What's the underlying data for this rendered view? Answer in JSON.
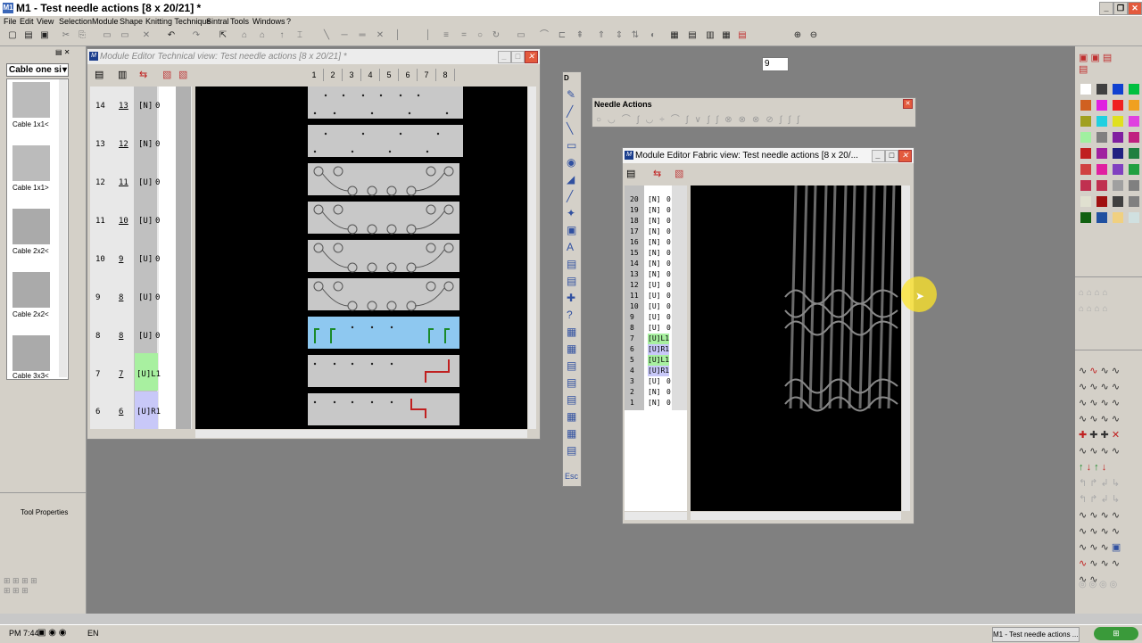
{
  "app": {
    "title": "M1 - Test needle actions [8 x 20/21] *",
    "icon": "M1"
  },
  "menu": [
    "File",
    "Edit",
    "View",
    "Selection",
    "Module",
    "Shape",
    "Knitting Technique",
    "Sintral",
    "Tools",
    "Windows",
    "?"
  ],
  "toolbar": {
    "zoom_value": "9"
  },
  "left_panel": {
    "dropdown": "Cable one si",
    "modules": [
      {
        "label": "Cable 1x1<"
      },
      {
        "label": "Cable 1x1>"
      },
      {
        "label": "Cable 2x2<"
      },
      {
        "label": "Cable 2x2<"
      },
      {
        "label": "Cable 3x3<"
      }
    ],
    "tool_properties": "Tool Properties"
  },
  "tech_view": {
    "title": "Module Editor Technical view: Test needle actions [8 x 20/21] *",
    "needles": [
      "1",
      "2",
      "3",
      "4",
      "5",
      "6",
      "7",
      "8"
    ],
    "rows": [
      {
        "n": "14",
        "m": "13",
        "code": "[N]",
        "v": "0"
      },
      {
        "n": "13",
        "m": "12",
        "code": "[N]",
        "v": "0"
      },
      {
        "n": "12",
        "m": "11",
        "code": "[U]",
        "v": "0"
      },
      {
        "n": "11",
        "m": "10",
        "code": "[U]",
        "v": "0"
      },
      {
        "n": "10",
        "m": "9",
        "code": "[U]",
        "v": "0"
      },
      {
        "n": "9",
        "m": "8",
        "code": "[U]",
        "v": "0"
      },
      {
        "n": "8",
        "m": "8",
        "code": "[U]",
        "v": "0"
      },
      {
        "n": "7",
        "m": "7",
        "code": "[U]L1",
        "v": ""
      },
      {
        "n": "6",
        "m": "6",
        "code": "[U]R1",
        "v": ""
      }
    ]
  },
  "vertical_toolbar": {
    "label": "D",
    "esc": "Esc"
  },
  "needle_actions": {
    "title": "Needle Actions"
  },
  "fabric_view": {
    "title": "Module Editor Fabric view: Test needle actions [8 x 20/...",
    "rows": [
      {
        "n": "20",
        "code": "[N]",
        "v": "0"
      },
      {
        "n": "19",
        "code": "[N]",
        "v": "0"
      },
      {
        "n": "18",
        "code": "[N]",
        "v": "0"
      },
      {
        "n": "17",
        "code": "[N]",
        "v": "0"
      },
      {
        "n": "16",
        "code": "[N]",
        "v": "0"
      },
      {
        "n": "15",
        "code": "[N]",
        "v": "0"
      },
      {
        "n": "14",
        "code": "[N]",
        "v": "0"
      },
      {
        "n": "13",
        "code": "[N]",
        "v": "0"
      },
      {
        "n": "12",
        "code": "[U]",
        "v": "0"
      },
      {
        "n": "11",
        "code": "[U]",
        "v": "0"
      },
      {
        "n": "10",
        "code": "[U]",
        "v": "0"
      },
      {
        "n": "9",
        "code": "[U]",
        "v": "0"
      },
      {
        "n": "8",
        "code": "[U]",
        "v": "0"
      },
      {
        "n": "7",
        "code": "[U]L1",
        "v": ""
      },
      {
        "n": "6",
        "code": "[U]R1",
        "v": ""
      },
      {
        "n": "5",
        "code": "[U]L1",
        "v": ""
      },
      {
        "n": "4",
        "code": "[U]R1",
        "v": ""
      },
      {
        "n": "3",
        "code": "[U]",
        "v": "0"
      },
      {
        "n": "2",
        "code": "[N]",
        "v": "0"
      },
      {
        "n": "1",
        "code": "[N]",
        "v": "0"
      }
    ]
  },
  "taskbar": {
    "time": "PM 7:44",
    "lang": "EN",
    "task": "M1 - Test needle actions ..."
  },
  "colors": {
    "accent_blue": "#8ec8f0",
    "green_row": "#a8f0a0",
    "purple_row": "#c8c8f8",
    "red_close": "#e35a3d"
  }
}
